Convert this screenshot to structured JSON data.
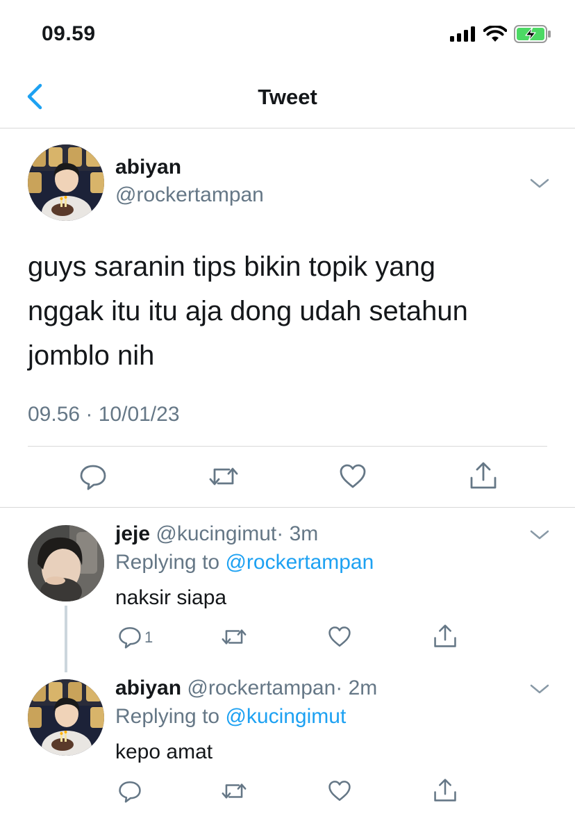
{
  "status_bar": {
    "time": "09.59",
    "icons": [
      "signal-icon",
      "wifi-icon",
      "battery-charging-icon"
    ],
    "battery_color": "#4cd964"
  },
  "nav": {
    "title": "Tweet",
    "back_icon": "chevron-left-icon",
    "accent": "#1da1f2"
  },
  "main_tweet": {
    "name": "abiyan",
    "handle": "@rockertampan",
    "text_lines": [
      "guys saranin tips bikin topik yang",
      "nggak itu itu aja dong udah setahun",
      "jomblo nih"
    ],
    "timestamp": "09.56 · 10/01/23",
    "actions": [
      "reply-icon",
      "retweet-icon",
      "like-icon",
      "share-icon"
    ]
  },
  "replies": [
    {
      "name": "jeje",
      "handle": "@kucingimut",
      "age": "· 3m",
      "replying_prefix": "Replying to ",
      "replying_to": "@rockertampan",
      "text": "naksir siapa",
      "reply_count": "1"
    },
    {
      "name": "abiyan",
      "handle": "@rockertampan",
      "age": "· 2m",
      "replying_prefix": "Replying to ",
      "replying_to": "@kucingimut",
      "text": "kepo amat",
      "reply_count": ""
    }
  ]
}
